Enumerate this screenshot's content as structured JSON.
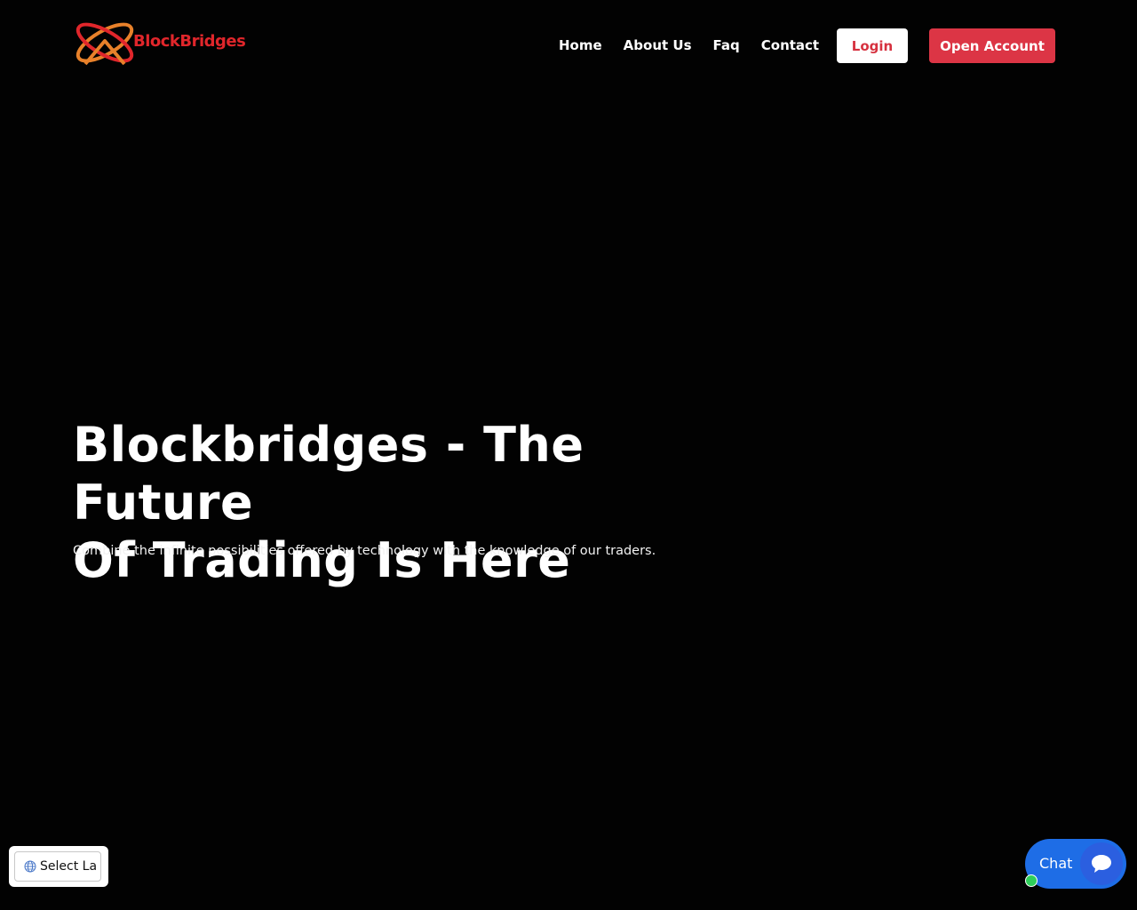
{
  "header": {
    "logo_text": "BlockBridges",
    "nav": {
      "home": "Home",
      "about": "About Us",
      "faq": "Faq",
      "contact": "Contact"
    },
    "login_label": "Login",
    "open_account_label": "Open Account"
  },
  "hero": {
    "title_line1": "Blockbridges - The Future",
    "title_line2": "Of Trading Is Here",
    "subtitle": "Combine the infinite possibilities offered by technology with the knowledge of our traders."
  },
  "language_selector": {
    "label": "Select La",
    "icon": "globe-icon"
  },
  "chat": {
    "label": "Chat",
    "icon": "chat-bubble-icon",
    "status": "online"
  },
  "colors": {
    "background": "#020202",
    "brand_red": "#dc3545",
    "login_text": "#d6313f",
    "logo_orange": "#e8812a",
    "logo_red": "#e0262b",
    "chat_blue": "#1e6de6",
    "online_green": "#2fcf5a"
  }
}
